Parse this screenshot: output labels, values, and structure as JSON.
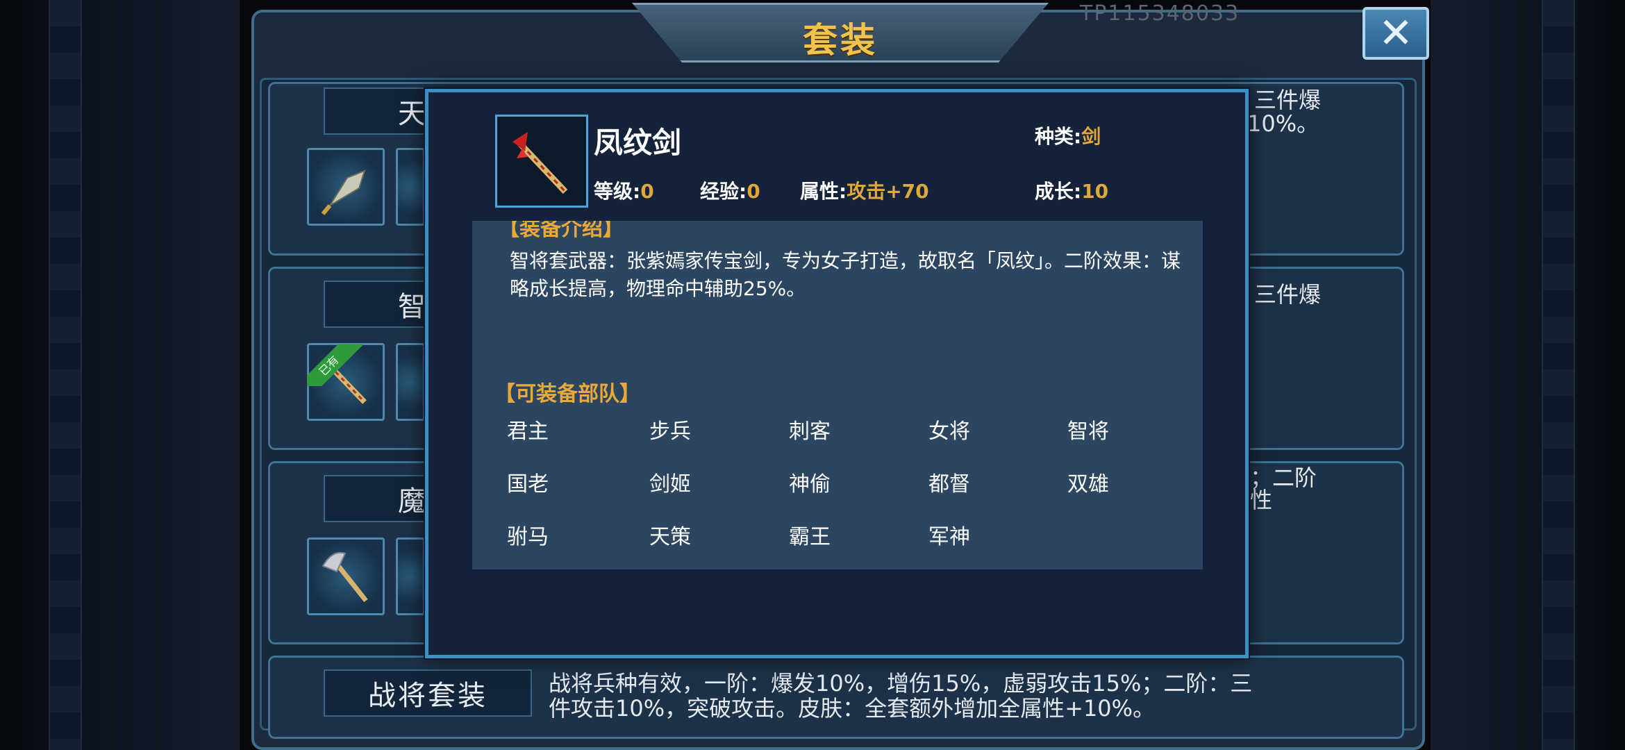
{
  "window": {
    "title": "套装",
    "faded_id": "TP115348033"
  },
  "sets": [
    {
      "name": "天师",
      "desc_fragment_1": "三件爆",
      "desc_fragment_2": "10%。"
    },
    {
      "name": "智将",
      "owned_badge": "已有",
      "desc_fragment_1": "三件爆"
    },
    {
      "name": "魔王",
      "desc_fragment_1": "；二阶",
      "desc_fragment_2": "性"
    },
    {
      "name": "战将套装",
      "desc_line_1": "战将兵种有效，一阶：爆发10%，增伤15%，虚弱攻击15%；二阶：三",
      "desc_line_2": "件攻击10%，突破攻击。皮肤：全套额外增加全属性+10%。"
    }
  ],
  "item": {
    "icon": "phoenix-sword-icon",
    "name": "凤纹剑",
    "type_label": "种类:",
    "type_value": "剑",
    "level_label": "等级:",
    "level_value": "0",
    "exp_label": "经验:",
    "exp_value": "0",
    "attr_label": "属性:",
    "attr_value": "攻击+70",
    "growth_label": "成长:",
    "growth_value": "10",
    "intro_header": "【装备介绍】",
    "intro_text": "智将套武器：张紫嫣家传宝剑，专为女子打造，故取名「凤纹」。二阶效果：谋略成长提高，物理命中辅助25%。",
    "units_header": "【可装备部队】",
    "units": [
      "君主",
      "步兵",
      "刺客",
      "女将",
      "智将",
      "国老",
      "剑姬",
      "神偷",
      "都督",
      "双雄",
      "驸马",
      "天策",
      "霸王",
      "军神"
    ]
  },
  "colors": {
    "accent_gold": "#e8a83a",
    "value_gold": "#e0a83a",
    "frame_blue": "#3a8fc4",
    "owned_green": "#2f9a3c"
  }
}
